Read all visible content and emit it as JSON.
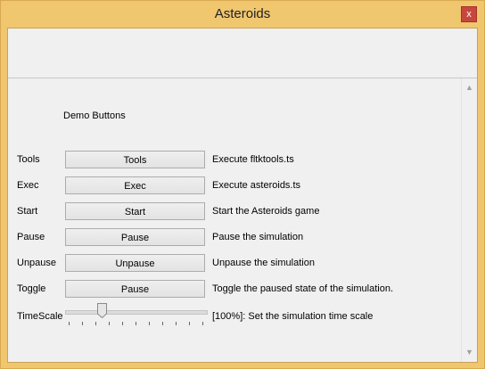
{
  "window": {
    "title": "Asteroids",
    "close_label": "x"
  },
  "panel": {
    "heading": "Demo Buttons"
  },
  "rows": [
    {
      "label": "Tools",
      "button": "Tools",
      "description": "Execute fltktools.ts"
    },
    {
      "label": "Exec",
      "button": "Exec",
      "description": "Execute asteroids.ts"
    },
    {
      "label": "Start",
      "button": "Start",
      "description": "Start the Asteroids game"
    },
    {
      "label": "Pause",
      "button": "Pause",
      "description": "Pause the simulation"
    },
    {
      "label": "Unpause",
      "button": "Unpause",
      "description": "Unpause the simulation"
    },
    {
      "label": "Toggle",
      "button": "Pause",
      "description": "Toggle the paused state of the simulation."
    }
  ],
  "timescale": {
    "label": "TimeScale",
    "description": "[100%]: Set the simulation time scale",
    "value_fraction": 0.26,
    "tick_count": 11
  },
  "colors": {
    "frame": "#f0c66e",
    "close": "#c8473c",
    "client": "#f0f0f0"
  }
}
